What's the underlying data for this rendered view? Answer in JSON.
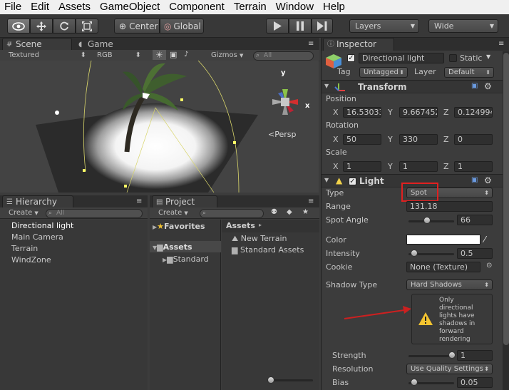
{
  "menu": [
    "File",
    "Edit",
    "Assets",
    "GameObject",
    "Component",
    "Terrain",
    "Window",
    "Help"
  ],
  "toolbar": {
    "center_label": "Center",
    "global_label": "Global",
    "layers_label": "Layers",
    "layout_label": "Wide"
  },
  "scene": {
    "tab_scene": "Scene",
    "tab_game": "Game",
    "render_mode": "Textured",
    "color_mode": "RGB",
    "gizmos_label": "Gizmos",
    "search_placeholder": "All",
    "persp_label": "Persp",
    "gizmo_y": "y",
    "gizmo_x": "x"
  },
  "hierarchy": {
    "tab_label": "Hierarchy",
    "create_label": "Create",
    "search_placeholder": "All",
    "items": [
      "Directional light",
      "Main Camera",
      "Terrain",
      "WindZone"
    ]
  },
  "project": {
    "tab_label": "Project",
    "create_label": "Create",
    "tree": {
      "favorites": "Favorites",
      "assets": "Assets",
      "standard": "Standard"
    },
    "assets_header": "Assets",
    "assets_items": [
      "New Terrain",
      "Standard Assets"
    ]
  },
  "inspector": {
    "tab_label": "Inspector",
    "object_name": "Directional light",
    "static_label": "Static",
    "tag_label": "Tag",
    "tag_value": "Untagged",
    "layer_label": "Layer",
    "layer_value": "Default",
    "transform": {
      "title": "Transform",
      "position_label": "Position",
      "rotation_label": "Rotation",
      "scale_label": "Scale",
      "axis_x": "X",
      "axis_y": "Y",
      "axis_z": "Z",
      "position": [
        "16.53033",
        "9.667452",
        "0.124994"
      ],
      "rotation": [
        "50",
        "330",
        "0"
      ],
      "scale": [
        "1",
        "1",
        "1"
      ]
    },
    "light": {
      "title": "Light",
      "type_label": "Type",
      "type_value": "Spot",
      "range_label": "Range",
      "range_value": "131.18",
      "spot_angle_label": "Spot Angle",
      "spot_angle_value": "66",
      "spot_angle_fraction": 0.37,
      "color_label": "Color",
      "intensity_label": "Intensity",
      "intensity_value": "0.5",
      "intensity_fraction": 0.06,
      "cookie_label": "Cookie",
      "cookie_value": "None (Texture)",
      "shadow_type_label": "Shadow Type",
      "shadow_type_value": "Hard Shadows",
      "warning_text": "Only directional lights have shadows in forward rendering",
      "strength_label": "Strength",
      "strength_value": "1",
      "strength_fraction": 1.0,
      "resolution_label": "Resolution",
      "resolution_value": "Use Quality Settings",
      "bias_label": "Bias",
      "bias_value": "0.05",
      "bias_fraction": 0.05
    }
  },
  "colors": {
    "highlight_box": "#e02020",
    "annotation_arrow": "#cc2020",
    "light_color_swatch": "#ffffff"
  }
}
